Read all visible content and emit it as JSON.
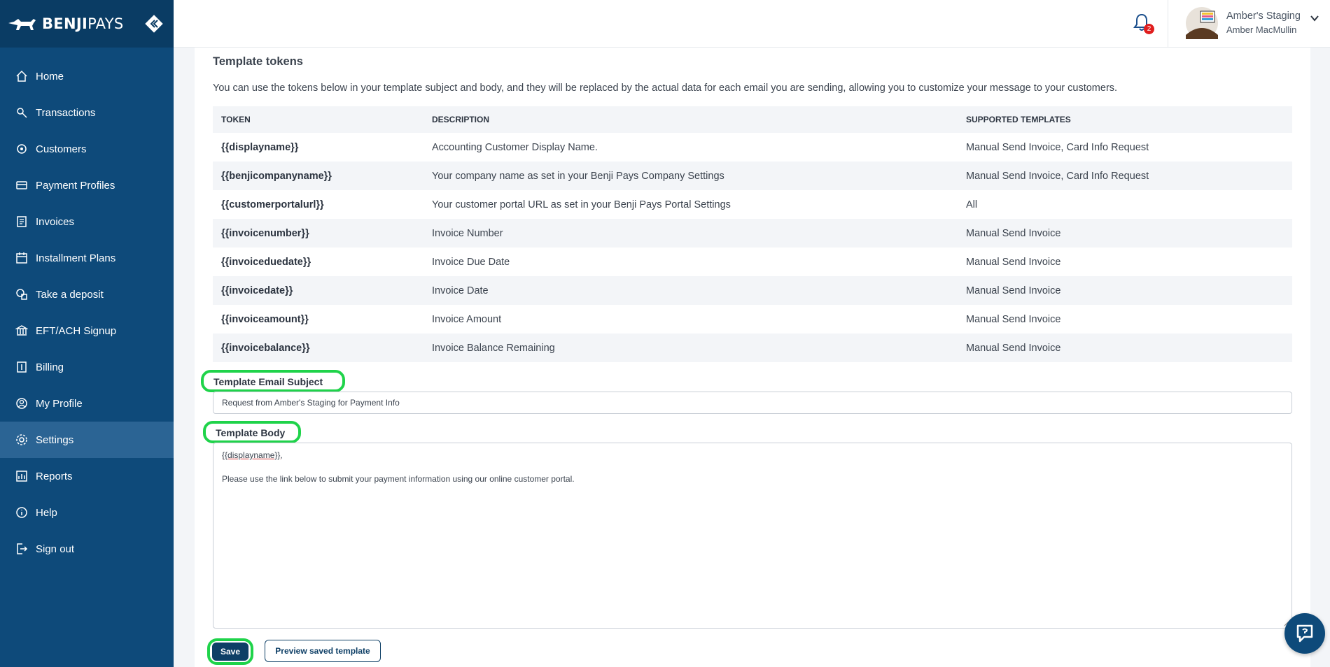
{
  "brand": {
    "name_bold": "BENJI",
    "name_light": "PAYS"
  },
  "sidebar": {
    "items": [
      {
        "label": "Home",
        "icon": "home-icon"
      },
      {
        "label": "Transactions",
        "icon": "transactions-icon"
      },
      {
        "label": "Customers",
        "icon": "customers-icon"
      },
      {
        "label": "Payment Profiles",
        "icon": "payment-profiles-icon"
      },
      {
        "label": "Invoices",
        "icon": "invoices-icon"
      },
      {
        "label": "Installment Plans",
        "icon": "installment-plans-icon"
      },
      {
        "label": "Take a deposit",
        "icon": "deposit-icon"
      },
      {
        "label": "EFT/ACH Signup",
        "icon": "bank-icon"
      },
      {
        "label": "Billing",
        "icon": "billing-icon"
      },
      {
        "label": "My Profile",
        "icon": "profile-icon"
      },
      {
        "label": "Settings",
        "icon": "settings-icon",
        "active": true
      },
      {
        "label": "Reports",
        "icon": "reports-icon"
      },
      {
        "label": "Help",
        "icon": "help-icon"
      },
      {
        "label": "Sign out",
        "icon": "sign-out-icon"
      }
    ]
  },
  "header": {
    "notification_count": "2",
    "org_name": "Amber's Staging",
    "user_name": "Amber MacMullin"
  },
  "tokens_section": {
    "title": "Template tokens",
    "description": "You can use the tokens below in your template subject and body, and they will be replaced by the actual data for each email you are sending, allowing you to customize your message to your customers.",
    "columns": [
      "TOKEN",
      "DESCRIPTION",
      "SUPPORTED TEMPLATES"
    ],
    "rows": [
      {
        "token": "{{displayname}}",
        "description": "Accounting Customer Display Name.",
        "supported": "Manual Send Invoice, Card Info Request"
      },
      {
        "token": "{{benjicompanyname}}",
        "description": "Your company name as set in your Benji Pays Company Settings",
        "supported": "Manual Send Invoice, Card Info Request"
      },
      {
        "token": "{{customerportalurl}}",
        "description": "Your customer portal URL as set in your Benji Pays Portal Settings",
        "supported": "All"
      },
      {
        "token": "{{invoicenumber}}",
        "description": "Invoice Number",
        "supported": "Manual Send Invoice"
      },
      {
        "token": "{{invoiceduedate}}",
        "description": "Invoice Due Date",
        "supported": "Manual Send Invoice"
      },
      {
        "token": "{{invoicedate}}",
        "description": "Invoice Date",
        "supported": "Manual Send Invoice"
      },
      {
        "token": "{{invoiceamount}}",
        "description": "Invoice Amount",
        "supported": "Manual Send Invoice"
      },
      {
        "token": "{{invoicebalance}}",
        "description": "Invoice Balance Remaining",
        "supported": "Manual Send Invoice"
      }
    ]
  },
  "form": {
    "subject_label": "Template Email Subject",
    "subject_value": "Request from Amber's Staging for Payment Info",
    "body_label": "Template Body",
    "body_line1_token": "{{displayname}}",
    "body_line1_suffix": ",",
    "body_line2": "Please use the link below to submit your payment information using our online customer portal.",
    "save_label": "Save",
    "preview_label": "Preview saved template"
  },
  "colors": {
    "sidebar": "#0e4a7a",
    "active": "#2b6494",
    "highlight": "#1fd34a",
    "primary_button": "#0e3f66"
  }
}
